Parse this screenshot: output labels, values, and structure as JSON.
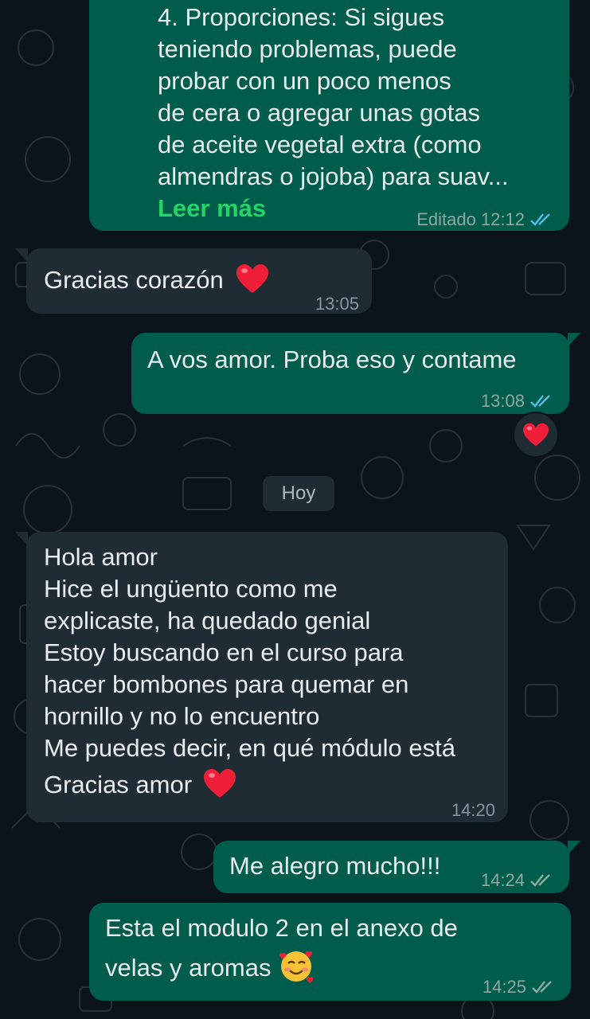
{
  "messages": [
    {
      "id": "m1",
      "direction": "outgoing",
      "lines": [
        "4. Proporciones: Si sigues",
        "teniendo problemas, puede",
        "probar con un poco menos",
        "de cera o agregar unas gotas",
        "de aceite vegetal extra (como",
        "almendras o jojoba) para suav..."
      ],
      "read_more": "Leer más",
      "meta": "Editado 12:12",
      "status": "read"
    },
    {
      "id": "m2",
      "direction": "incoming",
      "text": "Gracias corazón",
      "emoji": "heart",
      "time": "13:05"
    },
    {
      "id": "m3",
      "direction": "outgoing",
      "text": "A vos amor. Proba eso y contame",
      "time": "13:08",
      "status": "read",
      "reaction": "heart"
    },
    {
      "id": "m4",
      "direction": "incoming",
      "lines": [
        "Hola amor",
        "Hice el ungüento como me",
        "explicaste, ha quedado genial",
        "Estoy buscando en el curso para",
        "hacer bombones para quemar en",
        "hornillo y no lo encuentro",
        "Me puedes decir, en qué módulo está",
        "Gracias amor"
      ],
      "emoji": "heart",
      "time": "14:20"
    },
    {
      "id": "m5",
      "direction": "outgoing",
      "text": "Me alegro mucho!!!",
      "time": "14:24",
      "status": "delivered"
    },
    {
      "id": "m6",
      "direction": "outgoing",
      "lines": [
        "Esta el modulo 2 en el anexo de",
        "velas y aromas"
      ],
      "emoji": "smiling-face-with-hearts",
      "time": "14:25",
      "status": "delivered"
    }
  ],
  "day_separator": "Hoy",
  "colors": {
    "background": "#0b141a",
    "outgoing_bubble": "#005c4b",
    "incoming_bubble": "#202c33",
    "read_ticks": "#53bdeb",
    "delivered_ticks": "#8fa9a1",
    "read_more": "#25d366"
  }
}
